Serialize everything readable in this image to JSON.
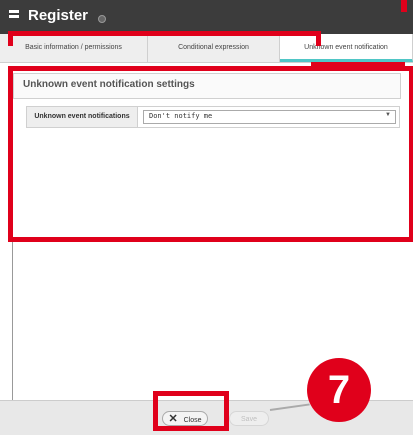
{
  "window": {
    "title": "Register"
  },
  "tabs": [
    {
      "label": "Basic information / permissions"
    },
    {
      "label": "Conditional expression"
    },
    {
      "label": "Unknown event notification"
    }
  ],
  "section": {
    "heading": "Unknown event notification settings"
  },
  "field": {
    "label": "Unknown event notifications",
    "value": "Don't notify me"
  },
  "footer": {
    "close_label": "Close",
    "save_label": "Save"
  },
  "annotation": {
    "step_number": "7"
  },
  "colors": {
    "highlight": "#e0001b",
    "active_tab_accent": "#4fc6c6",
    "titlebar": "#3c3c3c"
  }
}
